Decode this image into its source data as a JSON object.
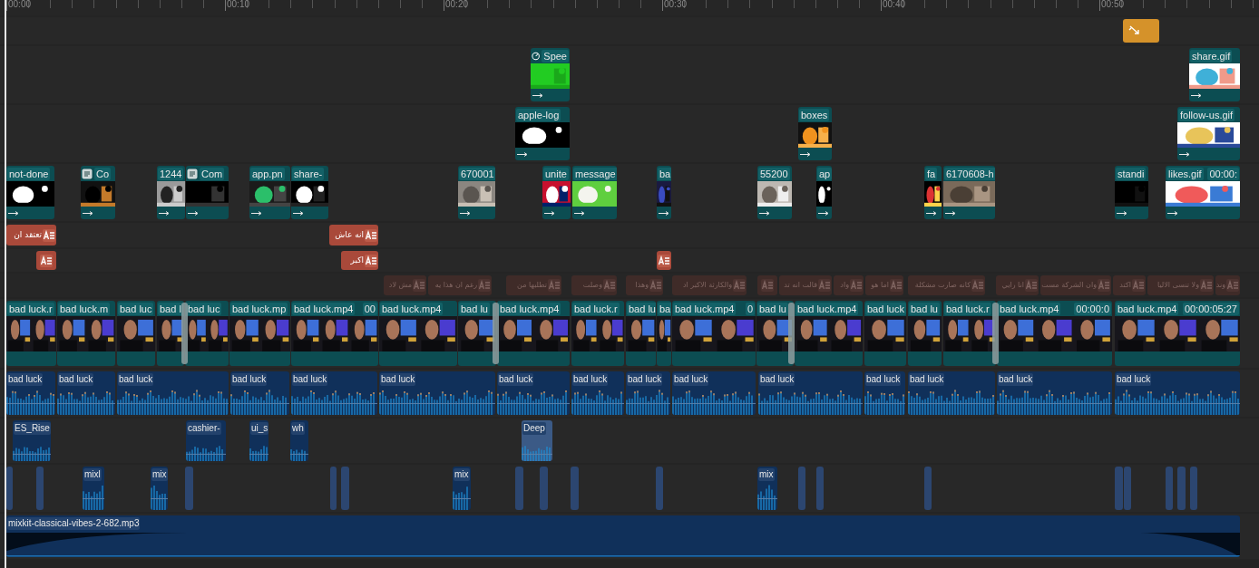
{
  "ruler": {
    "ticks": [
      "00:00",
      "00:10",
      "00:20",
      "00:30",
      "00:40",
      "00:50"
    ]
  },
  "tracks": [
    {
      "kind": "effect",
      "muted": false,
      "clips": [
        {
          "kind": "transition"
        }
      ]
    },
    {
      "kind": "overlay",
      "muted": false,
      "clips": [
        {
          "kind": "speed",
          "label": "Spee"
        },
        {
          "kind": "media",
          "label": "share.gif"
        }
      ]
    },
    {
      "kind": "overlay",
      "muted": false,
      "clips": [
        {
          "label": "apple-log"
        },
        {
          "label": "boxes"
        },
        {
          "label": "follow-us.gif"
        }
      ]
    },
    {
      "kind": "overlay",
      "muted": false,
      "clips": [
        {
          "kind": "media",
          "label": "not-done"
        },
        {
          "kind": "doc",
          "label": "Co"
        },
        {
          "kind": "media",
          "label": "1244"
        },
        {
          "kind": "doc",
          "label": "Com"
        },
        {
          "kind": "media",
          "label": "app.pn"
        },
        {
          "kind": "media",
          "label": "share-"
        },
        {
          "kind": "media",
          "label": "670001"
        },
        {
          "kind": "media",
          "label": "unite"
        },
        {
          "kind": "media",
          "label": "message"
        },
        {
          "kind": "media",
          "label": "ba"
        },
        {
          "kind": "media",
          "label": "55200"
        },
        {
          "kind": "media",
          "label": "ap"
        },
        {
          "kind": "media",
          "label": "fa"
        },
        {
          "kind": "media",
          "label": "6170608-h"
        },
        {
          "kind": "media",
          "label": "standi"
        },
        {
          "kind": "media",
          "label": "likes.gif",
          "timecode": "00:00:"
        }
      ]
    },
    {
      "kind": "text",
      "muted": false,
      "clips": [
        {
          "label": "انه عاش"
        },
        {
          "label": "تعتقد ان"
        }
      ]
    },
    {
      "kind": "text",
      "muted": false,
      "clips": [
        {
          "kind": "caption"
        },
        {
          "label": "اكبر"
        },
        {
          "kind": "caption"
        }
      ]
    },
    {
      "kind": "text",
      "muted": true,
      "clips": [
        {
          "label": "وند"
        },
        {
          "label": "ولا تنسى الاليا"
        },
        {
          "label": "اكتد"
        },
        {
          "label": "وان الشركة مست"
        },
        {
          "label": "انا رايي"
        },
        {
          "label": "كانه صارت مشكلة"
        },
        {
          "label": "اما هو"
        },
        {
          "label": "واد"
        },
        {
          "label": "قالت انه تد"
        },
        {
          "kind": "caption"
        },
        {
          "label": "والكارثة الاكبر اد"
        },
        {
          "label": "وهذا"
        },
        {
          "label": "وصلت"
        },
        {
          "label": "تطلبها من"
        },
        {
          "label": "رغم ان هذا يه"
        },
        {
          "label": "مش لاد"
        }
      ]
    },
    {
      "kind": "video",
      "muted": false,
      "clips": [
        {
          "label": "bad luck.r"
        },
        {
          "label": "bad luck.m"
        },
        {
          "label": "bad luc"
        },
        {
          "label": "bad l"
        },
        {
          "label": "bad luc"
        },
        {
          "label": "bad luck.mp"
        },
        {
          "label": "bad luck.mp4",
          "timecode": "00"
        },
        {
          "label": "bad luck.mp4"
        },
        {
          "label": "bad lu"
        },
        {
          "label": "bad luck.mp4"
        },
        {
          "label": "bad luck.r"
        },
        {
          "label": "bad lu"
        },
        {
          "label": "ba"
        },
        {
          "label": "bad luck.mp4",
          "timecode": "0"
        },
        {
          "label": "bad lu"
        },
        {
          "label": "bad luck.mp4"
        },
        {
          "label": "bad luck"
        },
        {
          "label": "bad lu"
        },
        {
          "label": "bad luck.r"
        },
        {
          "label": "bad luck.mp4",
          "timecode": "00:00:0"
        },
        {
          "label": "bad luck.mp4",
          "timecode": "00:00:05:27"
        }
      ]
    },
    {
      "kind": "audio",
      "muted": false,
      "clips": [
        {
          "label": "bad luck"
        },
        {
          "label": "bad luck"
        },
        {
          "label": "bad luck"
        },
        {
          "label": "bad luck"
        },
        {
          "label": "bad luck"
        },
        {
          "label": "bad luck"
        },
        {
          "label": "bad luck"
        },
        {
          "label": "bad luck"
        },
        {
          "label": "bad luck"
        },
        {
          "label": "bad luck"
        },
        {
          "label": "bad luck"
        },
        {
          "label": "bad luck"
        },
        {
          "label": "bad luck"
        },
        {
          "label": "bad luck"
        },
        {
          "label": "bad luck"
        }
      ]
    },
    {
      "kind": "audio",
      "muted": false,
      "clips": [
        {
          "label": "ES_Rise",
          "selected": false
        },
        {
          "label": "cashier-",
          "selected": false
        },
        {
          "label": "ui_s",
          "selected": false
        },
        {
          "label": "wh",
          "selected": false
        },
        {
          "label": "Deep",
          "selected": true
        }
      ]
    },
    {
      "kind": "audio",
      "muted": false,
      "clips": [
        {
          "kind": "sound"
        },
        {
          "kind": "sound"
        },
        {
          "label": "mixl"
        },
        {
          "label": "mix"
        },
        {
          "kind": "sound"
        },
        {
          "kind": "sound"
        },
        {
          "kind": "sound"
        },
        {
          "label": "mix"
        },
        {
          "kind": "sound"
        },
        {
          "kind": "sound"
        },
        {
          "kind": "sound"
        },
        {
          "kind": "sound"
        },
        {
          "label": "mix"
        },
        {
          "kind": "sound"
        },
        {
          "kind": "sound"
        },
        {
          "kind": "sound"
        },
        {
          "kind": "sound"
        },
        {
          "kind": "sound"
        },
        {
          "kind": "sound"
        },
        {
          "kind": "sound"
        },
        {
          "kind": "sound"
        }
      ]
    },
    {
      "kind": "audio",
      "muted": false,
      "clips": [
        {
          "label": "mixkit-classical-vibes-2-682.mp3"
        }
      ]
    }
  ]
}
